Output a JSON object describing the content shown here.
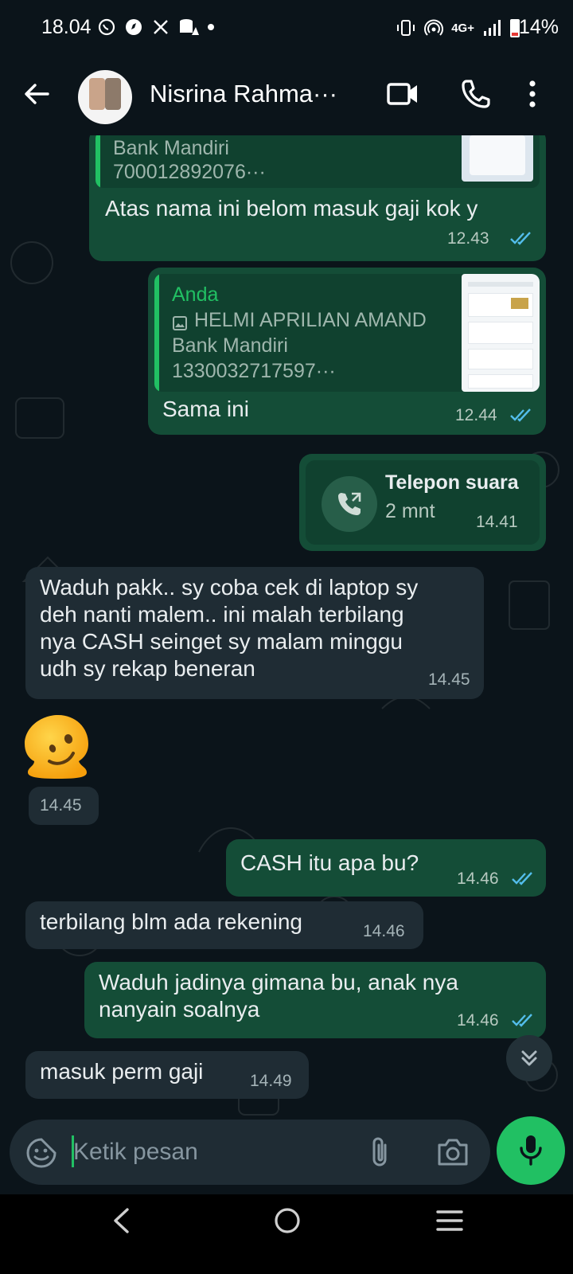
{
  "status_bar": {
    "time": "18.04",
    "network": "4G+",
    "battery": "14%"
  },
  "header": {
    "contact_name": "Nisrina Rahma···"
  },
  "messages": [
    {
      "type": "out",
      "quote_lines": [
        "Bank Mandiri",
        "700012892076···"
      ],
      "text": "Atas nama ini belom masuk gaji kok y",
      "time": "12.43"
    },
    {
      "type": "out",
      "quote_author": "Anda",
      "quote_lines": [
        "HELMI APRILIAN AMAND",
        "Bank Mandiri",
        "1330032717597···"
      ],
      "text": "Sama ini",
      "time": "12.44"
    },
    {
      "type": "call",
      "title": "Telepon suara",
      "duration": "2 mnt",
      "time": "14.41"
    },
    {
      "type": "in",
      "lines": [
        "Waduh pakk.. sy coba cek di laptop sy",
        "deh nanti malem.. ini malah terbilang",
        "nya CASH seinget sy malam minggu",
        "udh sy rekap beneran"
      ],
      "time": "14.45"
    },
    {
      "type": "sticker",
      "time": "14.45"
    },
    {
      "type": "out",
      "text": "CASH itu apa bu?",
      "time": "14.46"
    },
    {
      "type": "in",
      "text": "terbilang blm ada rekening",
      "time": "14.46"
    },
    {
      "type": "out",
      "lines": [
        "Waduh jadinya gimana bu, anak nya",
        "nanyain soalnya"
      ],
      "time": "14.46"
    },
    {
      "type": "in",
      "text": "masuk perm gaji",
      "time": "14.49"
    }
  ],
  "input": {
    "placeholder": "Ketik pesan"
  },
  "colors": {
    "outgoing": "#144d37",
    "incoming": "#1f2c34",
    "accent": "#21c063",
    "read_ticks": "#53bdeb"
  }
}
